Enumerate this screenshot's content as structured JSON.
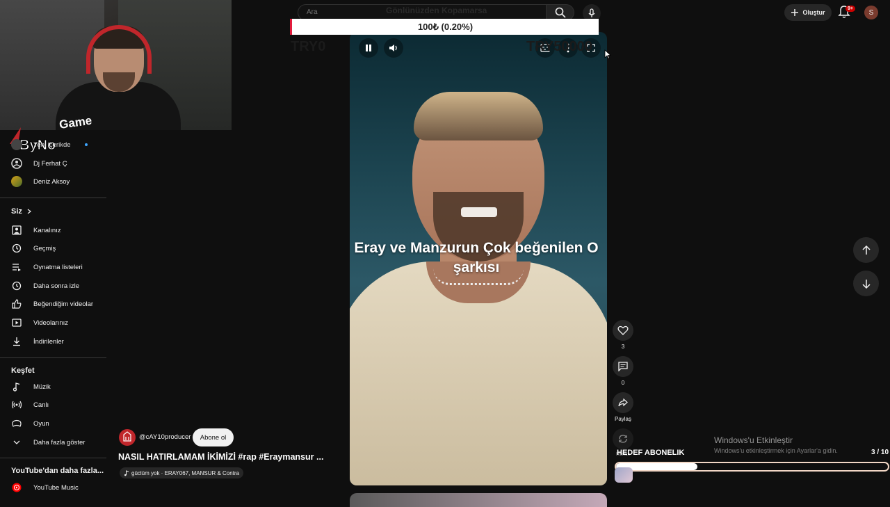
{
  "overlay": {
    "logo_text": "ByNo Game",
    "donation": "100₺ (0.20%)",
    "goal_current": "TRY0",
    "goal_target": "TRY50000",
    "ghost_title": "Gönlünüzden Kopamarsa"
  },
  "header": {
    "search_placeholder": "Ara",
    "create_label": "Oluştur",
    "notification_badge": "9+",
    "profile_initial": "S"
  },
  "sidebar": {
    "subscriptions": [
      {
        "label": "Yeni içerikde",
        "icon": "avatar",
        "has_dot": true
      },
      {
        "label": "Dj Ferhat Ç",
        "icon": "avatar"
      },
      {
        "label": "Deniz Aksoy",
        "icon": "avatar"
      }
    ],
    "you_title": "Siz",
    "you_items": [
      {
        "label": "Kanalınız",
        "icon": "channel-icon"
      },
      {
        "label": "Geçmiş",
        "icon": "history-icon"
      },
      {
        "label": "Oynatma listeleri",
        "icon": "playlist-icon"
      },
      {
        "label": "Daha sonra izle",
        "icon": "clock-icon"
      },
      {
        "label": "Beğendiğim videolar",
        "icon": "thumbs-up-icon"
      },
      {
        "label": "Videolarınız",
        "icon": "video-icon"
      },
      {
        "label": "İndirilenler",
        "icon": "download-icon"
      }
    ],
    "explore_title": "Keşfet",
    "explore_items": [
      {
        "label": "Müzik",
        "icon": "music-icon"
      },
      {
        "label": "Canlı",
        "icon": "live-icon"
      },
      {
        "label": "Oyun",
        "icon": "gaming-icon"
      },
      {
        "label": "Daha fazla göster",
        "icon": "chevron-down-icon"
      }
    ],
    "more_title": "YouTube'dan daha fazla...",
    "more_items": [
      {
        "label": "YouTube Music",
        "icon": "youtube-music-icon"
      }
    ]
  },
  "video": {
    "caption": "Eray ve Manzurun Çok beğenilen O şarkısı",
    "channel": "@cAY10producer",
    "subscribe_label": "Abone ol",
    "title": "NASIL HATIRLAMAM İKİMİZİ #rap #Eraymansur ...",
    "music": "güclüm yok · ERAY067, MANSUR & Contra"
  },
  "actions": {
    "like_count": "3",
    "comment_count": "0",
    "share_label": "Paylaş",
    "remix_label": "Remix"
  },
  "goal": {
    "title": "HEDEF ABONELIK",
    "count": "3 / 10",
    "progress": 0.3
  },
  "watermark": {
    "title": "Windows'u Etkinleştir",
    "subtitle": "Windows'u etkinleştirmek için Ayarlar'a gidin."
  }
}
